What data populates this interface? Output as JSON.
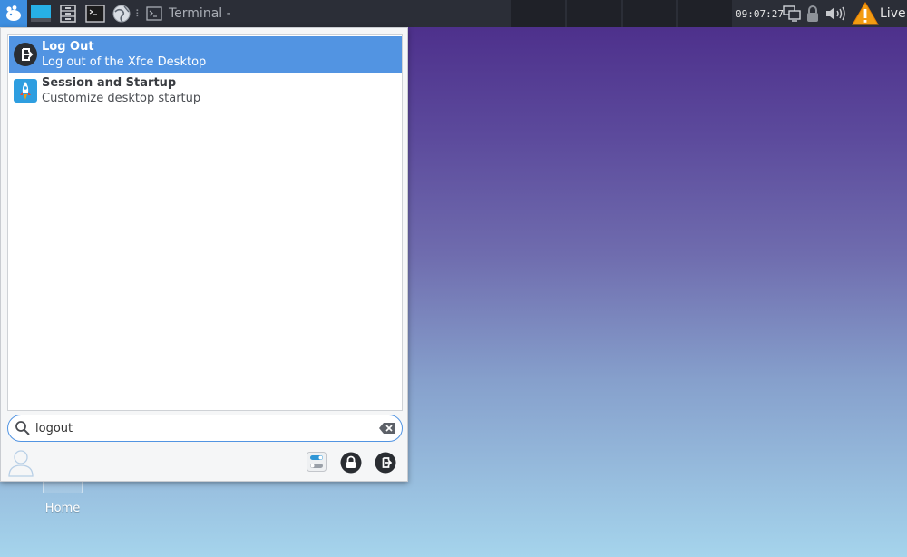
{
  "panel": {
    "task_title": "Terminal -",
    "separator": "⠇",
    "clock": "09:07:27",
    "live_label": "Live"
  },
  "desktop": {
    "home_label": "Home"
  },
  "menu": {
    "results": [
      {
        "name": "Log Out",
        "description": "Log out of the Xfce Desktop",
        "icon": "logout-icon",
        "selected": true
      },
      {
        "name": "Session and Startup",
        "description": "Customize desktop startup",
        "icon": "rocket-icon",
        "selected": false
      }
    ],
    "search": {
      "value": "logout"
    },
    "colors": {
      "selection": "#5294e2",
      "panel": "#2b2e37",
      "whisker_button": "#3d8ee0"
    }
  }
}
